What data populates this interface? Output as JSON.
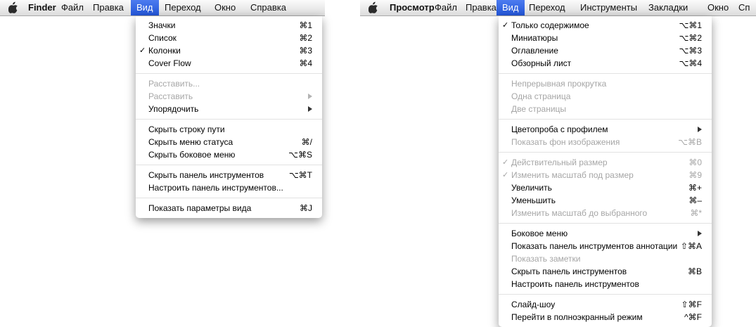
{
  "finder": {
    "menubar": [
      "Finder",
      "Файл",
      "Правка",
      "Вид",
      "Переход",
      "Окно",
      "Справка"
    ],
    "menu": [
      {
        "label": "Значки",
        "shortcut": "⌘1"
      },
      {
        "label": "Список",
        "shortcut": "⌘2"
      },
      {
        "label": "Колонки",
        "shortcut": "⌘3",
        "checked": true
      },
      {
        "label": "Cover Flow",
        "shortcut": "⌘4"
      },
      {
        "sep": true
      },
      {
        "label": "Расставить...",
        "disabled": true
      },
      {
        "label": "Расставить",
        "disabled": true,
        "submenu": true
      },
      {
        "label": "Упорядочить",
        "submenu": true
      },
      {
        "sep": true
      },
      {
        "label": "Скрыть строку пути"
      },
      {
        "label": "Скрыть меню статуса",
        "shortcut": "⌘/"
      },
      {
        "label": "Скрыть боковое меню",
        "shortcut": "⌥⌘S"
      },
      {
        "sep": true
      },
      {
        "label": "Скрыть панель инструментов",
        "shortcut": "⌥⌘T"
      },
      {
        "label": "Настроить панель инструментов..."
      },
      {
        "sep": true
      },
      {
        "label": "Показать параметры вида",
        "shortcut": "⌘J"
      }
    ]
  },
  "preview": {
    "menubar": [
      "Просмотр",
      "Файл",
      "Правка",
      "Вид",
      "Переход",
      "Инструменты",
      "Закладки",
      "Окно",
      "Сп"
    ],
    "menu": [
      {
        "label": "Только содержимое",
        "shortcut": "⌥⌘1",
        "checked": true
      },
      {
        "label": "Миниатюры",
        "shortcut": "⌥⌘2"
      },
      {
        "label": "Оглавление",
        "shortcut": "⌥⌘3"
      },
      {
        "label": "Обзорный лист",
        "shortcut": "⌥⌘4"
      },
      {
        "sep": true
      },
      {
        "label": "Непрерывная прокрутка",
        "disabled": true
      },
      {
        "label": "Одна страница",
        "disabled": true
      },
      {
        "label": "Две страницы",
        "disabled": true
      },
      {
        "sep": true
      },
      {
        "label": "Цветопроба с профилем",
        "submenu": true
      },
      {
        "label": "Показать фон изображения",
        "shortcut": "⌥⌘B",
        "disabled": true
      },
      {
        "sep": true
      },
      {
        "label": "Действительный размер",
        "shortcut": "⌘0",
        "disabled": true,
        "checked": true
      },
      {
        "label": "Изменить масштаб под размер",
        "shortcut": "⌘9",
        "disabled": true,
        "checked": true
      },
      {
        "label": "Увеличить",
        "shortcut": "⌘+"
      },
      {
        "label": "Уменьшить",
        "shortcut": "⌘–"
      },
      {
        "label": "Изменить масштаб до выбранного",
        "shortcut": "⌘*",
        "disabled": true
      },
      {
        "sep": true
      },
      {
        "label": "Боковое меню",
        "submenu": true
      },
      {
        "label": "Показать панель инструментов аннотации",
        "shortcut": "⇧⌘A"
      },
      {
        "label": "Показать заметки",
        "disabled": true
      },
      {
        "label": "Скрыть панель инструментов",
        "shortcut": "⌘B"
      },
      {
        "label": "Настроить панель инструментов"
      },
      {
        "sep": true
      },
      {
        "label": "Слайд-шоу",
        "shortcut": "⇧⌘F"
      },
      {
        "label": "Перейти в полноэкранный режим",
        "shortcut": "^⌘F"
      }
    ]
  },
  "icons": {
    "apple": "apple-icon",
    "check": "✓"
  },
  "colors": {
    "highlight": "#2f62dd",
    "disabled_text": "#a6a6a6"
  }
}
